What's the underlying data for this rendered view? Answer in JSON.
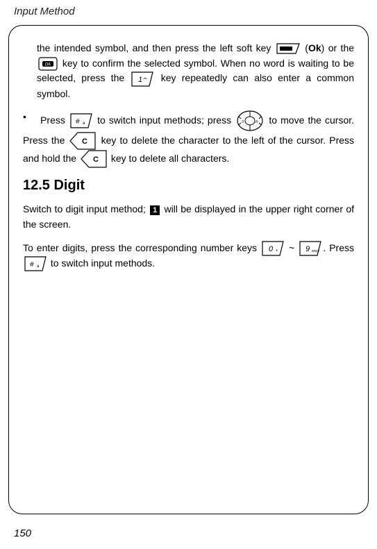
{
  "header": "Input Method",
  "page_number": "150",
  "p1_a": "the intended symbol, and then press the left soft key ",
  "p1_b": " (",
  "p1_ok": "Ok",
  "p1_c": ") or the ",
  "p1_d": " key to confirm the selected symbol. When no word is waiting to be selected, press the ",
  "p1_e": " key repeatedly can also enter a common symbol.",
  "bullet_symbol": "•",
  "b1_a": "Press ",
  "b1_b": " to switch input methods; press ",
  "b1_c": " to move the cursor. Press the ",
  "b1_d": " key to delete the character to the left of the cursor. Press and hold the ",
  "b1_e": " key to delete all characters.",
  "section_title": "12.5 Digit",
  "p2_a": "Switch to digit input method; ",
  "p2_b": " will be displayed in the upper right corner of the screen.",
  "p3_a": "To enter digits, press the corresponding number keys ",
  "p3_tilde": " ~ ",
  "p3_b": ". Press ",
  "p3_c": " to switch input methods.",
  "digit_indicator": "1",
  "icons": {
    "softkey": "softkey-icon",
    "ok": "ok-key-icon",
    "one": "one-key-icon",
    "hash": "hash-key-icon",
    "nav": "navigation-key-icon",
    "clear": "clear-key-icon",
    "num0": "zero-key-icon",
    "num9": "nine-key-icon"
  }
}
